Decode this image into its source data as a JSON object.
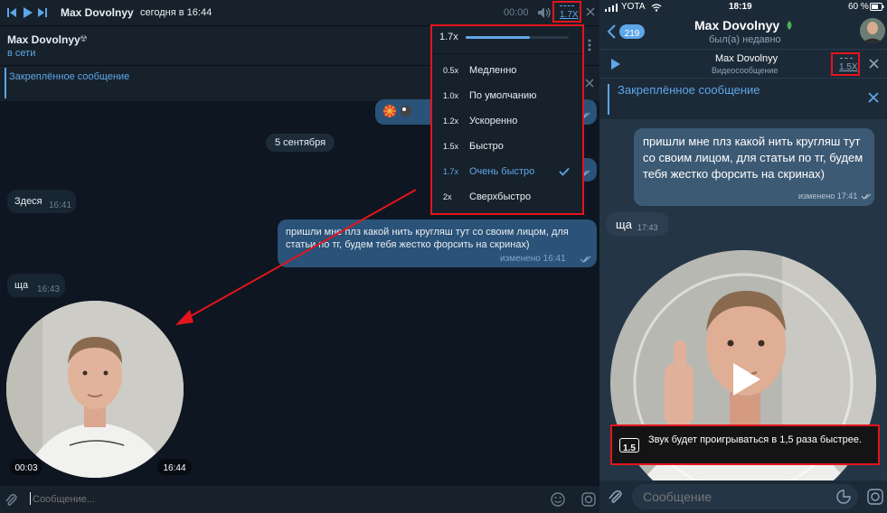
{
  "left": {
    "topbar": {
      "title": "Max Dovolnyy",
      "subtitle": "сегодня в 16:44",
      "time": "00:00",
      "speed": "1.7X"
    },
    "header": {
      "name": "Max Dovolnyy",
      "status": "в сети"
    },
    "pinned": {
      "label": "Закреплённое сообщение"
    },
    "speed_menu": {
      "current": "1.7x",
      "items": [
        {
          "value": "0.5x",
          "label": "Медленно"
        },
        {
          "value": "1.0x",
          "label": "По умолчанию"
        },
        {
          "value": "1.2x",
          "label": "Ускоренно"
        },
        {
          "value": "1.5x",
          "label": "Быстро"
        },
        {
          "value": "1.7x",
          "label": "Очень быстро",
          "selected": true
        },
        {
          "value": "2x",
          "label": "Сверхбыстро"
        }
      ],
      "progress": 0.62
    },
    "date_badge": "5 сентября",
    "messages": [
      {
        "text": "Здеся",
        "time": "16:41"
      },
      {
        "text": "пришли мне плз какой нить кругляш тут со своим лицом, для статьи по тг, будем тебя жестко форсить на скринах)",
        "time": "изменено 16:41"
      },
      {
        "text": "ща",
        "time": "16:43"
      }
    ],
    "video": {
      "elapsed": "00:03",
      "time": "16:44"
    },
    "composer": {
      "placeholder": "Сообщение..."
    }
  },
  "right": {
    "status": {
      "carrier": "YOTA",
      "time": "18:19",
      "battery": "60 %"
    },
    "header": {
      "back_count": "219",
      "name": "Max Dovolnyy",
      "status": "был(а) недавно"
    },
    "player": {
      "name": "Max Dovolnyy",
      "type": "Видеосообщение",
      "speed": "1.5X"
    },
    "pinned": {
      "label": "Закреплённое сообщение"
    },
    "messages": [
      {
        "text": "пришли мне плз какой нить кругляш тут со своим лицом, для статьи по тг, будем тебя жестко форсить на скринах)",
        "time": "изменено 17:41"
      },
      {
        "text": "ща",
        "time": "17:43"
      }
    ],
    "toast": {
      "badge": "1.5",
      "text": "Звук будет проигрываться в 1,5 раза быстрее."
    },
    "composer": {
      "placeholder": "Сообщение"
    }
  },
  "colors": {
    "accent": "#5ea6e8",
    "highlight": "#e4141c",
    "bg_dark": "#0e1621",
    "panel": "#17212b",
    "bubble_out": "#2b5278",
    "bubble_in": "#182533"
  }
}
